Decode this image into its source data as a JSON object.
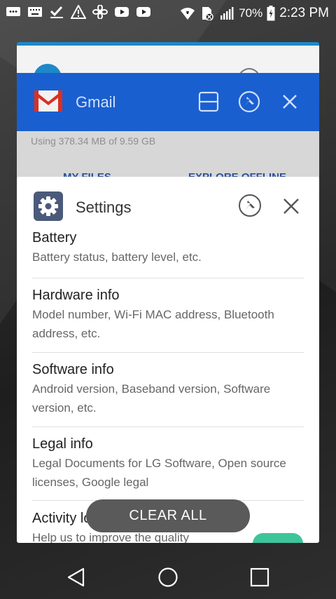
{
  "status_bar": {
    "battery": "70%",
    "time": "2:23 PM",
    "left_icons": [
      "message-icon",
      "keyboard-icon",
      "check-icon",
      "warning-icon",
      "fan-icon",
      "youtube-icon",
      "youtube-icon"
    ],
    "right_icons": [
      "wifi-icon",
      "no-sim-icon",
      "signal-icon",
      "battery-charging-icon"
    ]
  },
  "gmail_card": {
    "title": "Gmail",
    "usage": "Using 378.34 MB of 9.59 GB",
    "tab_left": "MY FILES",
    "tab_right": "EXPLORE OFFLINE"
  },
  "settings_card": {
    "title": "Settings",
    "items": [
      {
        "title": "Battery",
        "subtitle": "Battery status, battery level, etc."
      },
      {
        "title": "Hardware info",
        "subtitle": "Model number, Wi-Fi MAC address, Bluetooth address, etc."
      },
      {
        "title": "Software info",
        "subtitle": "Android version, Baseband version, Software version, etc."
      },
      {
        "title": "Legal info",
        "subtitle": "Legal Documents for LG Software, Open source licenses, Google legal"
      },
      {
        "title": "Activity logs",
        "subtitle": "Help us to improve the quality"
      }
    ]
  },
  "clear_all": "CLEAR ALL",
  "colors": {
    "gmail_header": "#1a5fcf",
    "toggle_on": "#3dc59a",
    "pill": "#5a5a5a"
  }
}
